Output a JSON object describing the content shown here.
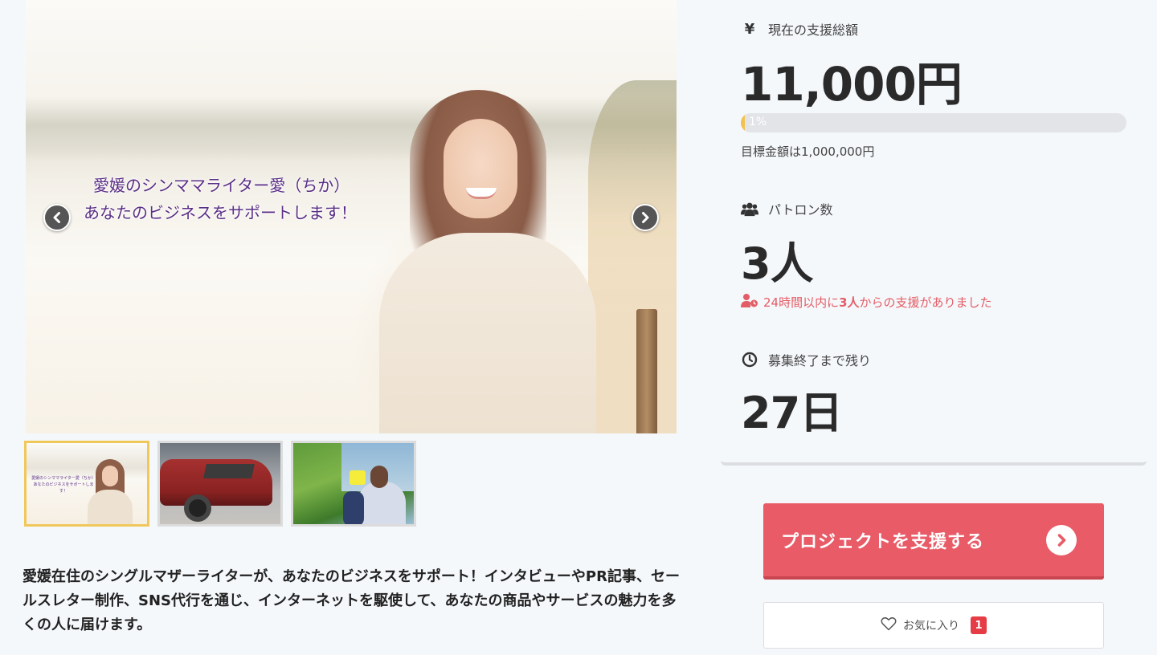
{
  "hero": {
    "caption_line1": "愛媛のシンママライター愛（ちか）",
    "caption_line2": "あなたのビジネスをサポートします！",
    "prev_icon": "chevron-left-icon",
    "next_icon": "chevron-right-icon"
  },
  "thumbnails": [
    {
      "kind": "portrait",
      "active": true
    },
    {
      "kind": "damaged-car",
      "active": false
    },
    {
      "kind": "mother-child",
      "active": false
    }
  ],
  "description": "愛媛在住のシングルマザーライターが、あなたのビジネスをサポート！インタビューやPR記事、セールスレター制作、SNS代行を通じ、インターネットを駆使して、あなたの商品やサービスの魅力を多くの人に届けます。",
  "stats": {
    "total": {
      "icon": "yen-icon",
      "icon_glyph": "¥",
      "label": "現在の支援総額",
      "value": "11,000円",
      "progress_percent": 1,
      "progress_label": "1%",
      "goal_text": "目標金額は1,000,000円"
    },
    "patrons": {
      "icon": "users-icon",
      "label": "パトロン数",
      "value": "3人",
      "recent_icon": "user-clock-icon",
      "recent_prefix": "24時間以内に",
      "recent_count": "3人",
      "recent_suffix": "からの支援がありました"
    },
    "remaining": {
      "icon": "clock-icon",
      "label": "募集終了まで残り",
      "value": "27日"
    }
  },
  "actions": {
    "support_label": "プロジェクトを支援する",
    "support_icon": "chevron-right-circle-icon",
    "favorite_label": "お気に入り",
    "favorite_icon": "heart-outline-icon",
    "favorite_count": "1"
  },
  "colors": {
    "accent_red": "#e85b67",
    "progress_yellow": "#f2c14e",
    "recent_text": "#e35d66",
    "badge_red": "#e63c45",
    "caption_purple": "#5b2f86"
  }
}
